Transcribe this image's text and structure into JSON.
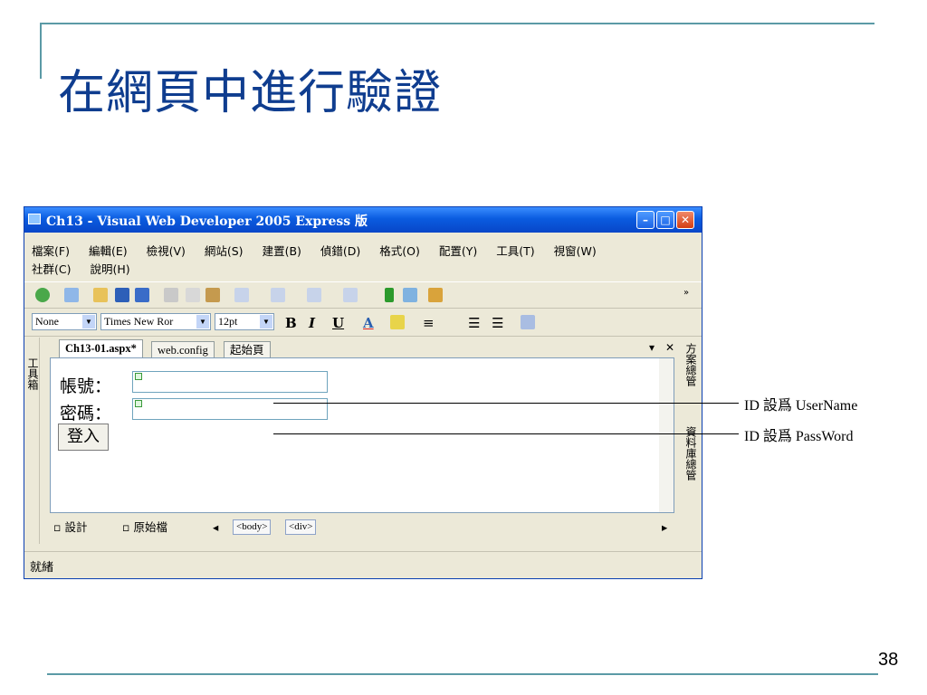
{
  "slide": {
    "title": "在網頁中進行驗證",
    "page_number": "38"
  },
  "window": {
    "title": "Ch13 - Visual Web Developer 2005 Express 版",
    "menu_row1": [
      "檔案(F)",
      "編輯(E)",
      "檢視(V)",
      "網站(S)",
      "建置(B)",
      "偵錯(D)",
      "格式(O)",
      "配置(Y)",
      "工具(T)",
      "視窗(W)"
    ],
    "menu_row2": [
      "社群(C)",
      "說明(H)"
    ],
    "format_toolbar": {
      "style": "None",
      "font": "Times New Ror",
      "size": "12pt"
    },
    "toolbox_label": "工具箱",
    "tabs": [
      "Ch13-01.aspx*",
      "web.config",
      "起始頁"
    ],
    "form": {
      "username_label": "帳號：",
      "password_label": "密碼：",
      "login_button": "登入"
    },
    "view_tabs": [
      "設計",
      "原始檔"
    ],
    "breadcrumb": [
      "<body>",
      "<div>"
    ],
    "right_panels": [
      "方案總管",
      "資料庫總管"
    ],
    "status": "就緒"
  },
  "annotations": {
    "username": "ID 設爲 UserName",
    "password": "ID 設爲 PassWord"
  }
}
